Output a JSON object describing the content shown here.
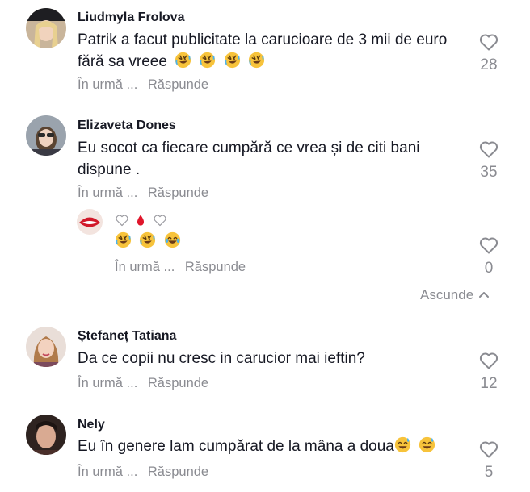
{
  "colors": {
    "text": "#161823",
    "muted": "#8a8b91",
    "background": "#ffffff"
  },
  "comments": [
    {
      "username": "Liudmyla Frolova",
      "text": "Patrik a facut publicitate la carucioare de 3 mii de euro fără sa vreee",
      "emojis": [
        "rofl-emoji",
        "rofl-emoji",
        "rofl-emoji",
        "rofl-emoji"
      ],
      "time": "În urmă ...",
      "reply_label": "Răspunde",
      "likes": "28"
    },
    {
      "username": "Elizaveta Dones",
      "text_line1": "Eu socot ca fiecare cumpără ce vrea și de citi bani",
      "text_line2": "dispune .",
      "time": "În urmă ...",
      "reply_label": "Răspunde",
      "likes": "35",
      "reply": {
        "emojis_line1": [
          "white-heart-emoji",
          "drop-of-blood-emoji",
          "white-heart-emoji"
        ],
        "emojis_line2": [
          "rofl-emoji",
          "rofl-emoji",
          "joy-emoji"
        ],
        "time": "În urmă ...",
        "reply_label": "Răspunde",
        "likes": "0"
      },
      "hide_label": "Ascunde"
    },
    {
      "username": "Ștefaneț Tatiana",
      "text": "Da ce copii nu cresc in carucior mai ieftin?",
      "time": "În urmă ...",
      "reply_label": "Răspunde",
      "likes": "12"
    },
    {
      "username": "Nely",
      "text": "Eu în genere lam cumpărat de la mâna a doua",
      "emojis": [
        "sweat-smile-emoji",
        "sweat-smile-emoji"
      ],
      "time": "În urmă ...",
      "reply_label": "Răspunde",
      "likes": "5"
    }
  ]
}
